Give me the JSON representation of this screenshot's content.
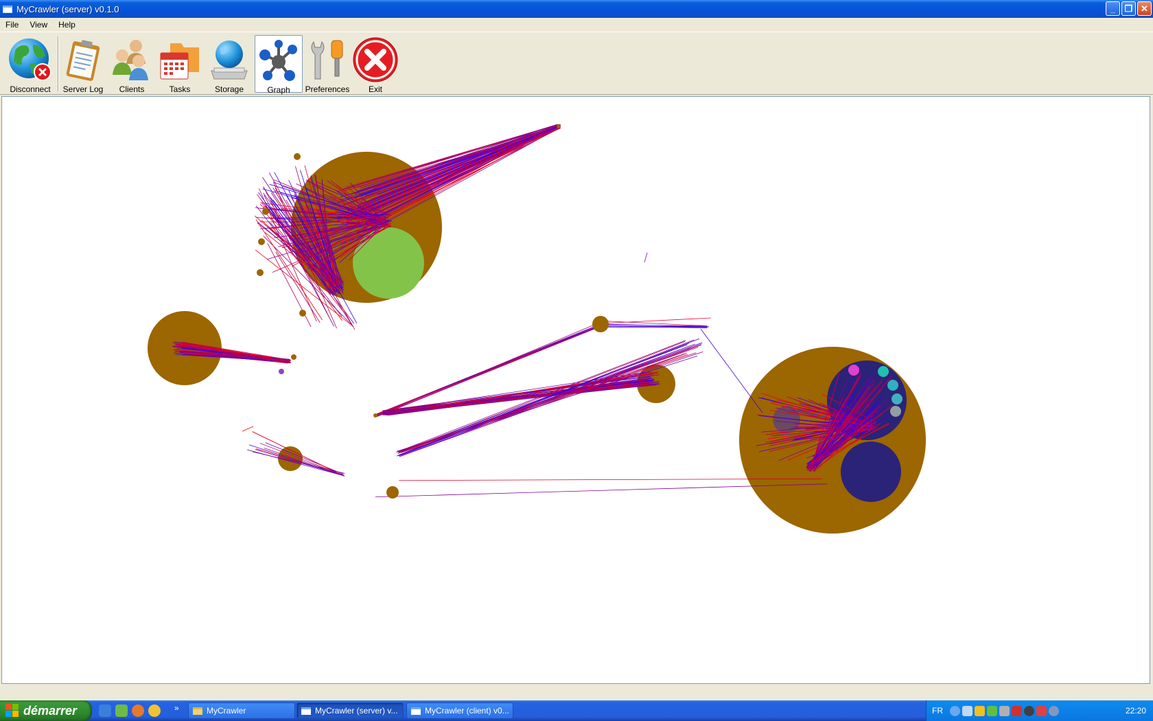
{
  "window": {
    "title": "MyCrawler (server) v0.1.0",
    "controls": {
      "minimize": "_",
      "maximize": "❐",
      "close": "✕"
    }
  },
  "menu": [
    "File",
    "View",
    "Help"
  ],
  "toolbar": [
    {
      "id": "disconnect",
      "label": "Disconnect",
      "icon": "globe-disconnect-icon"
    },
    {
      "id": "server-log",
      "label": "Server Log",
      "icon": "clipboard-icon"
    },
    {
      "id": "clients",
      "label": "Clients",
      "icon": "users-icon"
    },
    {
      "id": "tasks",
      "label": "Tasks",
      "icon": "calendar-folder-icon"
    },
    {
      "id": "storage",
      "label": "Storage",
      "icon": "globe-drive-icon"
    },
    {
      "id": "graph",
      "label": "Graph",
      "icon": "molecule-icon",
      "active": true
    },
    {
      "id": "preferences",
      "label": "Preferences",
      "icon": "tools-icon"
    },
    {
      "id": "exit",
      "label": "Exit",
      "icon": "exit-icon"
    }
  ],
  "graph": {
    "colors": {
      "node": "#9c6600",
      "edge_start": "#2200ff",
      "edge_end": "#ff0000",
      "green_node": "#83c34a",
      "navy_node": "#2b2377"
    }
  },
  "taskbar": {
    "start_label": "démarrer",
    "more_label": "»",
    "tasks": [
      {
        "label": "MyCrawler",
        "icon": "folder-icon"
      },
      {
        "label": "MyCrawler (server) v...",
        "icon": "window-icon",
        "active": true
      },
      {
        "label": "MyCrawler (client) v0...",
        "icon": "window-icon"
      }
    ],
    "tray": {
      "language": "FR",
      "clock": "22:20"
    }
  }
}
